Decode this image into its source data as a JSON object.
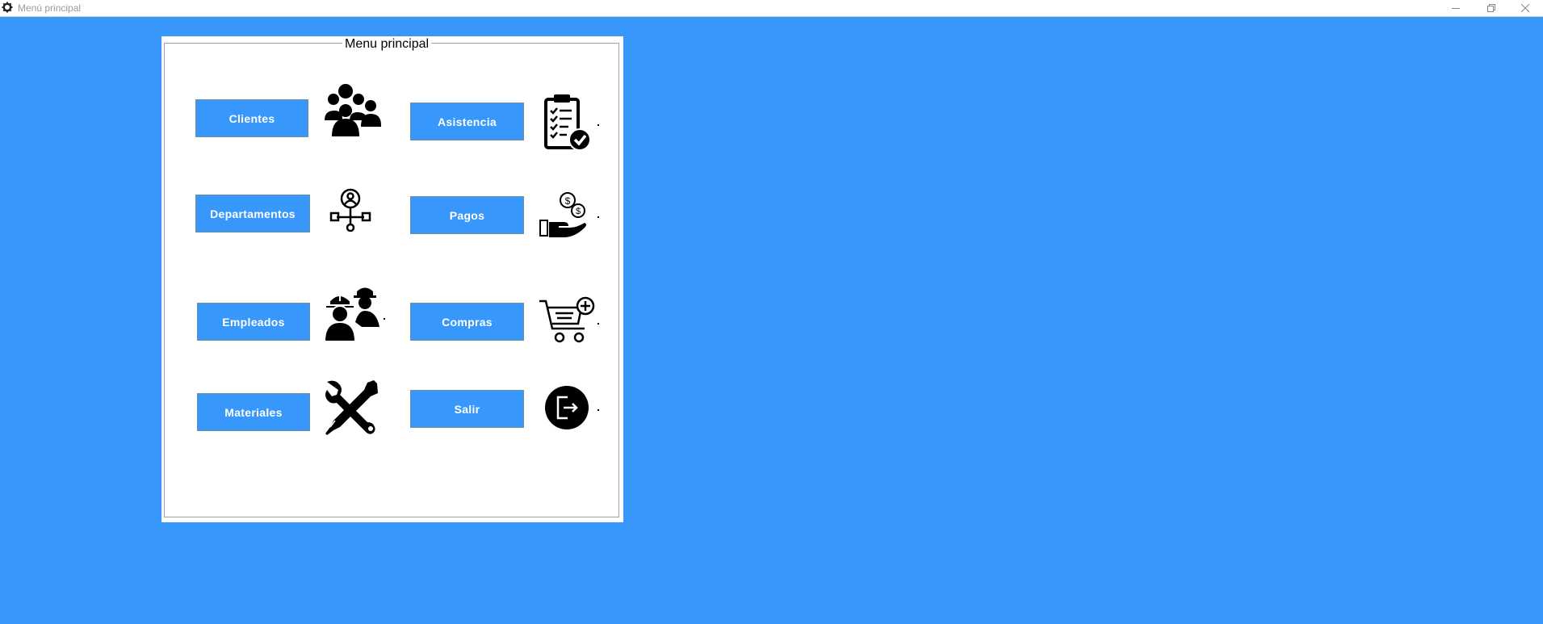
{
  "window": {
    "title": "Menú principal",
    "icon": "gear-icon",
    "controls": [
      "minimize-icon",
      "restore-icon",
      "close-icon"
    ]
  },
  "colors": {
    "background": "#3797FB",
    "button": "#3797FB",
    "button_text": "#FFFFFF",
    "panel": "#FFFFFF"
  },
  "panel": {
    "title": "Menu principal"
  },
  "menu": {
    "clientes": {
      "label": "Clientes",
      "icon": "group-people-icon"
    },
    "asistencia": {
      "label": "Asistencia",
      "icon": "clipboard-check-icon"
    },
    "departamentos": {
      "label": "Departamentos",
      "icon": "org-chart-icon"
    },
    "pagos": {
      "label": "Pagos",
      "icon": "hand-money-icon"
    },
    "empleados": {
      "label": "Empleados",
      "icon": "workers-helmet-icon"
    },
    "compras": {
      "label": "Compras",
      "icon": "cart-add-icon"
    },
    "materiales": {
      "label": "Materiales",
      "icon": "tools-icon"
    },
    "salir": {
      "label": "Salir",
      "icon": "exit-door-icon"
    }
  }
}
